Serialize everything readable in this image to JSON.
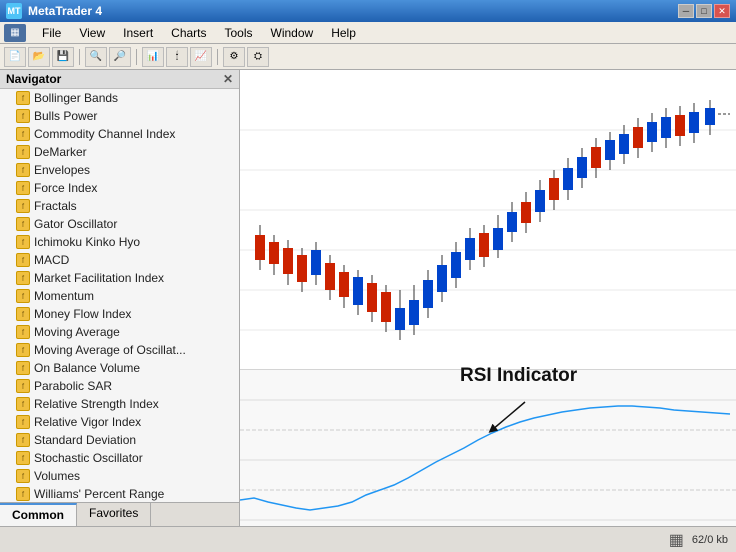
{
  "titleBar": {
    "title": "MetaTrader 4",
    "icon": "MT",
    "controls": [
      "minimize",
      "restore",
      "close"
    ]
  },
  "menuBar": {
    "items": [
      "File",
      "View",
      "Insert",
      "Charts",
      "Tools",
      "Window",
      "Help"
    ]
  },
  "navigator": {
    "title": "Navigator",
    "indicators": [
      "Bollinger Bands",
      "Bulls Power",
      "Commodity Channel Index",
      "DeMarker",
      "Envelopes",
      "Force Index",
      "Fractals",
      "Gator Oscillator",
      "Ichimoku Kinko Hyo",
      "MACD",
      "Market Facilitation Index",
      "Momentum",
      "Money Flow Index",
      "Moving Average",
      "Moving Average of Oscillat...",
      "On Balance Volume",
      "Parabolic SAR",
      "Relative Strength Index",
      "Relative Vigor Index",
      "Standard Deviation",
      "Stochastic Oscillator",
      "Volumes",
      "Williams' Percent Range"
    ],
    "tabs": [
      "Common",
      "Favorites"
    ]
  },
  "chart": {
    "rsiLabel": "RSI Indicator"
  },
  "statusBar": {
    "fileSize": "62/0 kb"
  }
}
